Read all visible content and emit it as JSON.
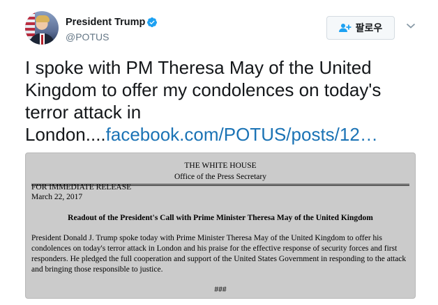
{
  "author": {
    "name": "President Trump",
    "handle": "@POTUS",
    "verified": true
  },
  "follow_button": {
    "label": "팔로우",
    "icon": "add-user-icon"
  },
  "menu_icon": "chevron-down-icon",
  "tweet": {
    "text": "I spoke with PM Theresa May of the United Kingdom to offer my condolences on today's terror attack in London....",
    "link_text": "facebook.com/POTUS/posts/12…",
    "link_color": "#1b73b5"
  },
  "media": {
    "header_line1": "THE WHITE HOUSE",
    "header_line2": "Office of the Press Secretary",
    "release_label": "FOR IMMEDIATE RELEASE",
    "release_date": "March 22, 2017",
    "title": "Readout of the President's Call with Prime Minister Theresa May of the United Kingdom",
    "body": "President Donald J. Trump spoke today with Prime Minister Theresa May of the United Kingdom to offer his condolences on today's terror attack in London and his praise for the effective response of security forces and first responders. He pledged the full cooperation and support of the United States Government in responding to the attack and bringing those responsible to justice.",
    "end_mark": "###"
  }
}
